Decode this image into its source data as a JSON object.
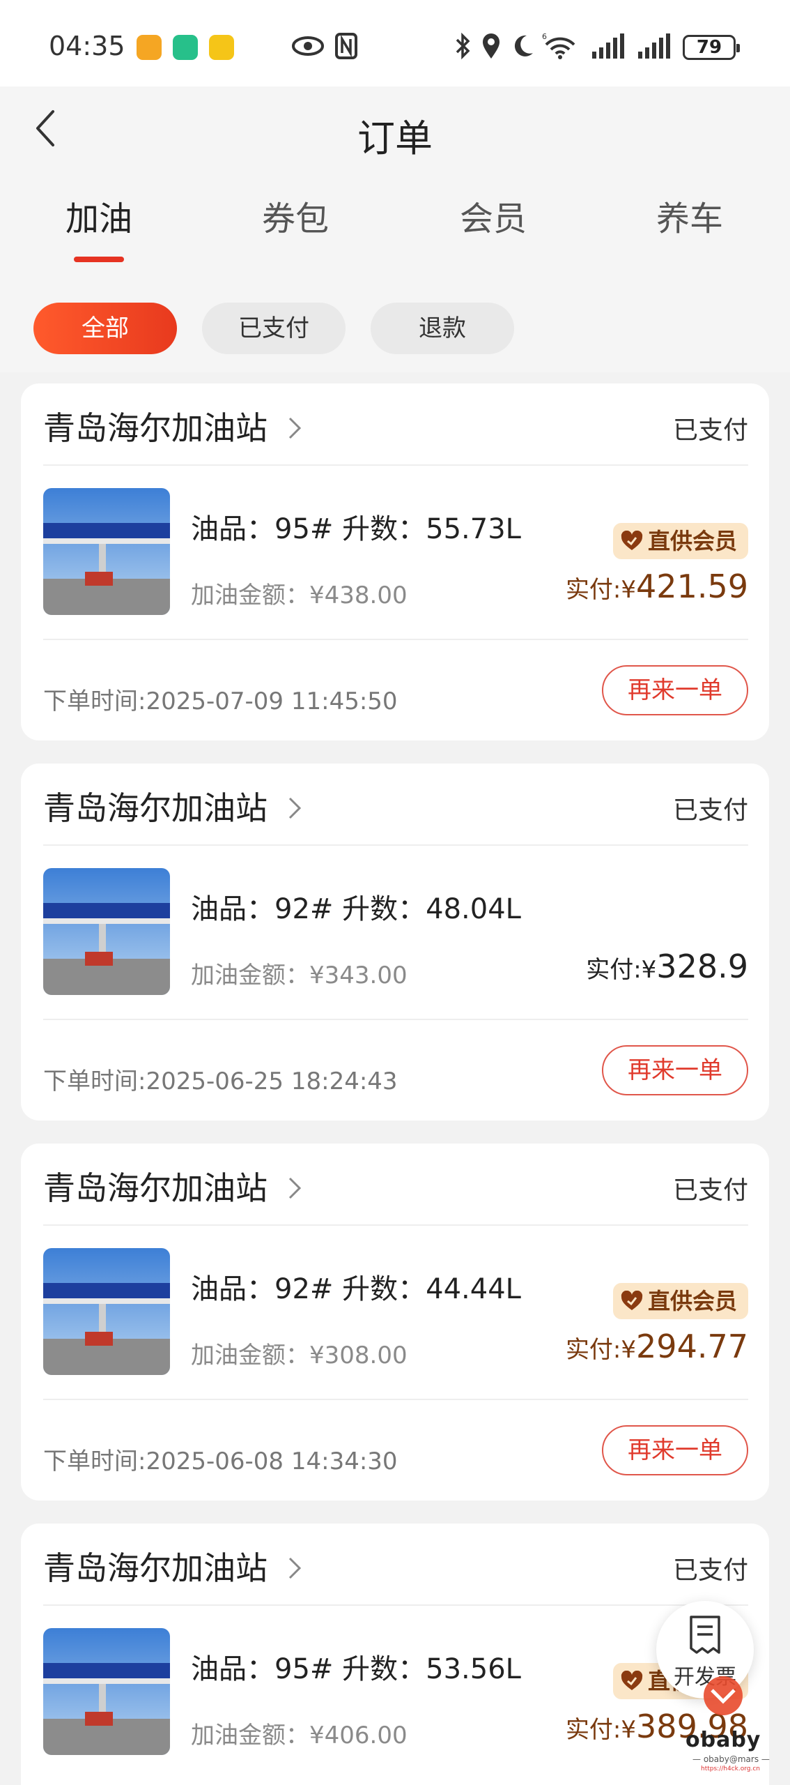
{
  "status_bar": {
    "time": "04:35",
    "battery": "79",
    "icons": [
      "app-orange-icon",
      "app-green-icon",
      "app-mail-icon",
      "eye-icon",
      "nfc-icon",
      "bluetooth-icon",
      "location-icon",
      "moon-icon",
      "wifi-6-icon",
      "signal-icon",
      "signal-icon-2"
    ]
  },
  "header": {
    "title": "订单",
    "tabs": [
      {
        "label": "加油"
      },
      {
        "label": "券包"
      },
      {
        "label": "会员"
      },
      {
        "label": "养车"
      }
    ],
    "filters": [
      {
        "label": "全部"
      },
      {
        "label": "已支付"
      },
      {
        "label": "退款"
      }
    ]
  },
  "orders": [
    {
      "station": "青岛海尔加油站",
      "status": "已支付",
      "fuel": "油品：95# 升数：55.73L",
      "amount": "加油金额：¥438.00",
      "badge": "直供会员",
      "paid_label": "实付:¥",
      "paid_value": "421.59",
      "time": "下单时间:2025-07-09 11:45:50",
      "reorder": "再来一单"
    },
    {
      "station": "青岛海尔加油站",
      "status": "已支付",
      "fuel": "油品：92# 升数：48.04L",
      "amount": "加油金额：¥343.00",
      "paid_label": "实付:¥",
      "paid_value": "328.9",
      "time": "下单时间:2025-06-25 18:24:43",
      "reorder": "再来一单"
    },
    {
      "station": "青岛海尔加油站",
      "status": "已支付",
      "fuel": "油品：92# 升数：44.44L",
      "amount": "加油金额：¥308.00",
      "badge": "直供会员",
      "paid_label": "实付:¥",
      "paid_value": "294.77",
      "time": "下单时间:2025-06-08 14:34:30",
      "reorder": "再来一单"
    },
    {
      "station": "青岛海尔加油站",
      "status": "已支付",
      "fuel": "油品：95# 升数：53.56L",
      "amount": "加油金额：¥406.00",
      "badge": "直供会员",
      "paid_label": "实付:¥",
      "paid_value": "389.98"
    }
  ],
  "invoice": {
    "label": "开发票"
  },
  "watermark": {
    "text": "obaby",
    "sub": "— obaby@mars —",
    "sub2": "https://h4ck.org.cn"
  },
  "colors": {
    "accent": "#e63322",
    "badge_bg": "#fbe6c8",
    "paid_brown": "#7a3a0e"
  }
}
